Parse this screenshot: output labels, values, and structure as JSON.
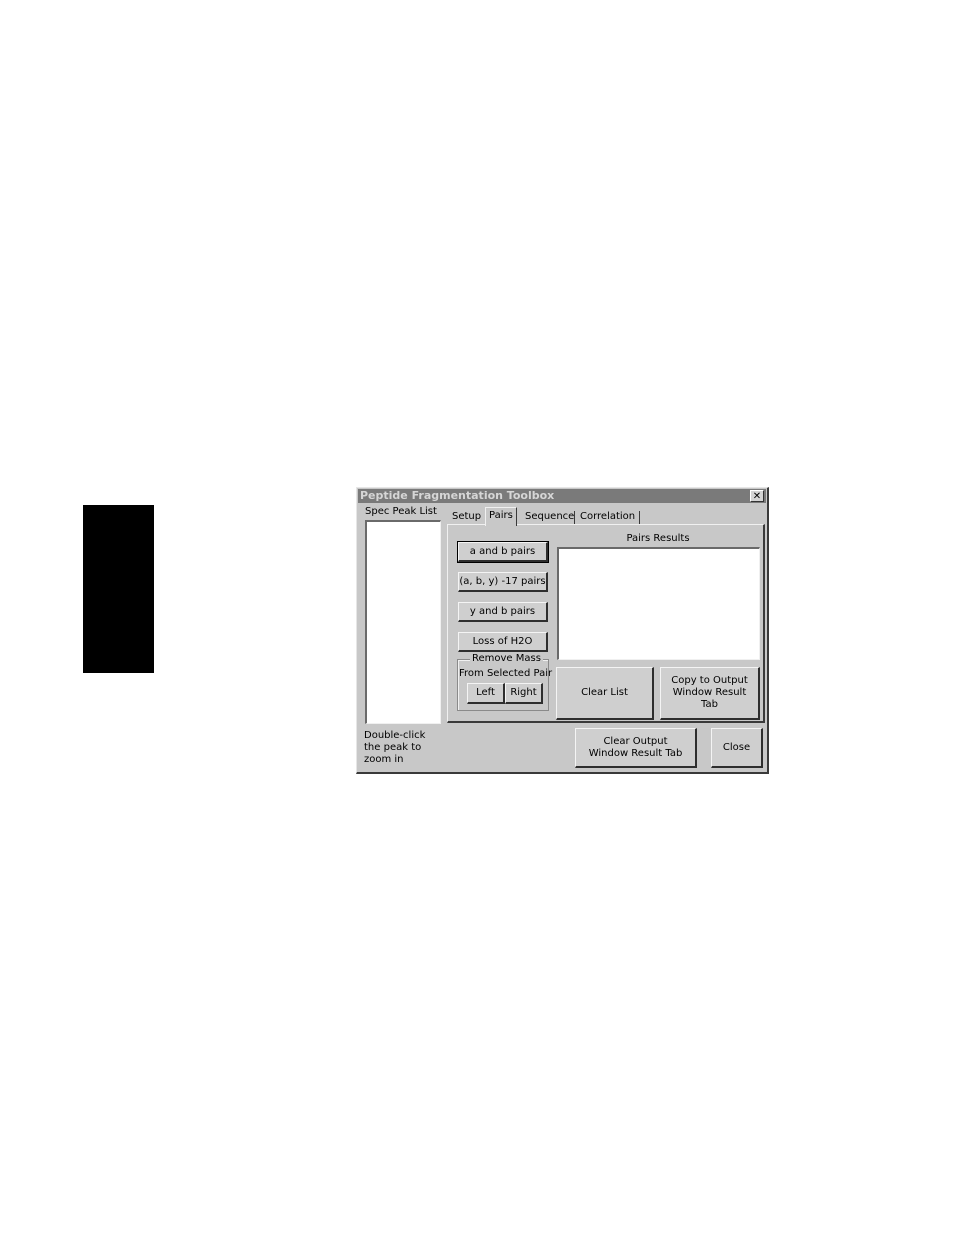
{
  "dialog": {
    "title": "Peptide Fragmentation Toolbox",
    "close_glyph": "✕"
  },
  "peak_list": {
    "label": "Spec Peak List",
    "hint": "Double-click the peak to zoom in"
  },
  "tabs": [
    {
      "label": "Setup",
      "active": false
    },
    {
      "label": "Pairs",
      "active": true
    },
    {
      "label": "Sequence",
      "active": false
    },
    {
      "label": "Correlation",
      "active": false
    }
  ],
  "pairs": {
    "buttons": {
      "a_and_b": "a and b pairs",
      "aby_17": "(a, b, y) -17 pairs",
      "y_and_b": "y and b pairs",
      "loss_h2o": "Loss of H2O"
    },
    "remove_mass": {
      "title": "Remove Mass",
      "subtitle": "From Selected Pair",
      "left": "Left",
      "right": "Right"
    },
    "results_label": "Pairs Results",
    "clear_list": "Clear List",
    "copy_output": "Copy to Output Window Result Tab"
  },
  "footer": {
    "clear_output": "Clear Output Window Result Tab",
    "close": "Close"
  }
}
